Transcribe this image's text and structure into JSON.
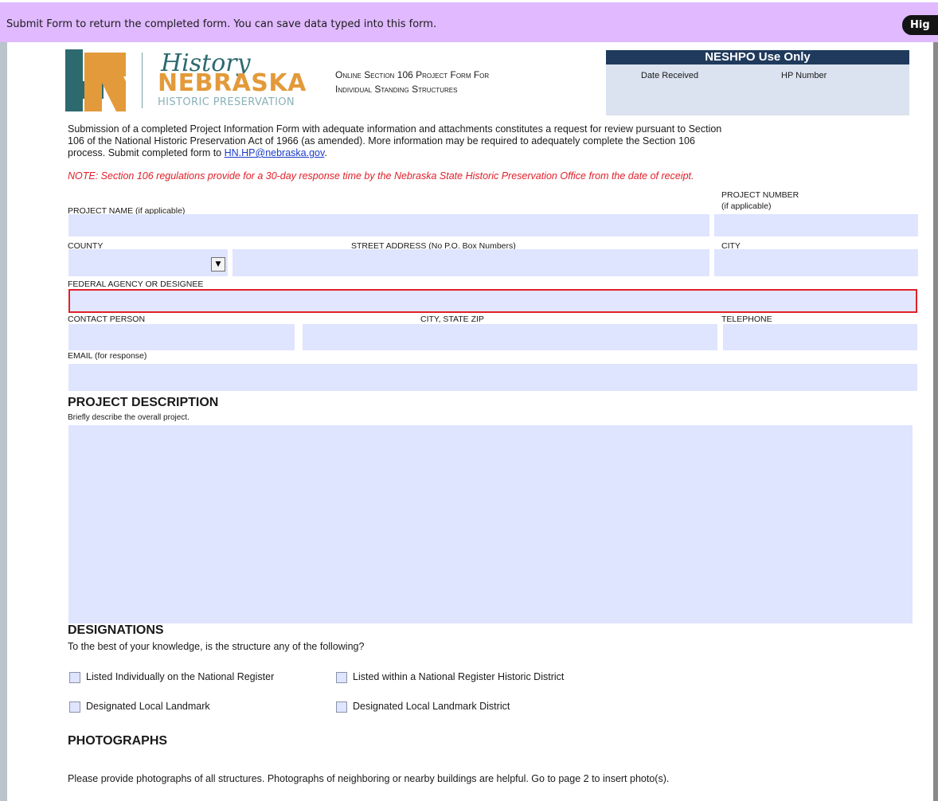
{
  "notice": {
    "text": "Submit Form to return the completed form. You can save data typed into this form.",
    "highlight_button": "Hig"
  },
  "logo": {
    "history": "History",
    "nebraska": "NEBRASKA",
    "sub": "HISTORIC PRESERVATION"
  },
  "form_title": {
    "line1": "Online Section 106 Project Form For",
    "line2": "Individual Standing Structures"
  },
  "neshpo": {
    "title": "NESHPO Use Only",
    "date_received": "Date Received",
    "hp_number": "HP Number"
  },
  "intro": {
    "line1": "Submission of a completed Project Information Form with adequate information and attachments constitutes a request for review pursuant to Section",
    "line2": "106 of the National Historic Preservation Act of 1966 (as amended). More information may be required to adequately complete the Section 106",
    "line3_prefix": "process. Submit completed form to ",
    "email": "HN.HP@nebraska.gov",
    "line3_suffix": ".",
    "note": "NOTE: Section 106 regulations provide for a 30-day response time by the Nebraska State Historic Preservation Office from the date of receipt."
  },
  "labels": {
    "project_name": "PROJECT NAME (if applicable)",
    "project_number_1": "PROJECT NUMBER",
    "project_number_2": "(if applicable)",
    "county": "COUNTY",
    "street_address": "STREET ADDRESS (No P.O. Box Numbers)",
    "city": "CITY",
    "federal_agency": "FEDERAL AGENCY OR DESIGNEE",
    "contact_person": "CONTACT PERSON",
    "city_state_zip": "CITY, STATE ZIP",
    "telephone": "TELEPHONE",
    "email": "EMAIL (for response)"
  },
  "fields": {
    "project_name": "",
    "project_number": "",
    "county": "",
    "street_address": "",
    "city": "",
    "federal_agency": "",
    "contact_person": "",
    "city_state_zip": "",
    "telephone": "",
    "email": "",
    "project_description": ""
  },
  "project_description": {
    "heading": "PROJECT DESCRIPTION",
    "hint": "Briefly describe the overall project."
  },
  "designations": {
    "heading": "DESIGNATIONS",
    "question": "To the best of your knowledge, is the structure any of the following?",
    "options": [
      "Listed Individually on the National Register",
      "Listed within a National Register Historic District",
      "Designated Local Landmark",
      "Designated Local Landmark District"
    ]
  },
  "photographs": {
    "heading": "PHOTOGRAPHS",
    "text": "Please provide photographs of all structures. Photographs of neighboring or nearby buildings are helpful. Go to page 2 to insert photo(s)."
  },
  "colors": {
    "notice_bg": "#e0b9ff",
    "field_bg": "#dfe4ff",
    "focus_border": "#e0202a",
    "neshpo_header": "#1f3a5c",
    "logo_teal": "#2c6a6f",
    "logo_orange": "#e39a3a"
  }
}
